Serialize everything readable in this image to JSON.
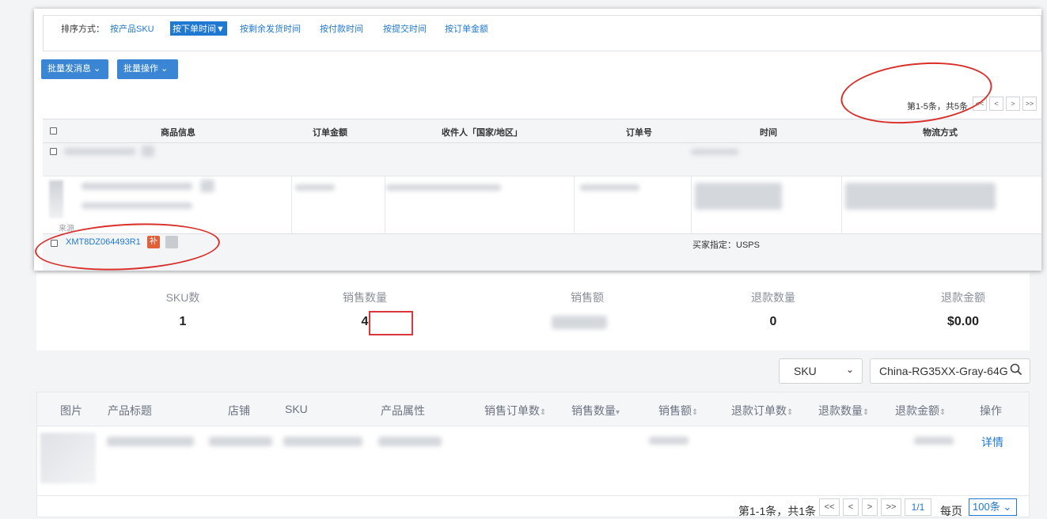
{
  "overlay": {
    "sort": {
      "label": "排序方式：",
      "options": [
        "按产品SKU",
        "按下单时间",
        "按剩余发货时间",
        "按付款时间",
        "按提交时间",
        "按订单金额"
      ],
      "active_suffix": "▼"
    },
    "buttons": {
      "batch_message": "批量发消息 ⌄",
      "batch_ops": "批量操作 ⌄"
    },
    "pager": {
      "text": "第1-5条，共5条",
      "first": "<<",
      "prev": "<",
      "next": ">",
      "last": ">>"
    },
    "table_headers": [
      "商品信息",
      "订单金额",
      "收件人「国家/地区」",
      "订单号",
      "时间",
      "物流方式"
    ],
    "order": {
      "id": "XMT8DZ064493R1",
      "badge": "补",
      "buyer_specified": "买家指定：USPS",
      "source_prefix": "来源"
    }
  },
  "stats": {
    "labels": [
      "SKU数",
      "销售数量",
      "销售额",
      "退款数量",
      "退款金额"
    ],
    "values": {
      "sku_count": "1",
      "sales_qty": "4",
      "refund_qty": "0",
      "refund_amount": "$0.00"
    }
  },
  "search": {
    "field": "SKU",
    "value": "China-RG35XX-Gray-64G"
  },
  "product_table": {
    "headers": [
      "图片",
      "产品标题",
      "店铺",
      "SKU",
      "产品属性",
      "销售订单数",
      "销售数量",
      "销售额",
      "退款订单数",
      "退款数量",
      "退款金额",
      "操作"
    ],
    "detail_link": "详情"
  },
  "pagination": {
    "text": "第1-1条，共1条",
    "first": "<<",
    "prev": "<",
    "next": ">",
    "last": ">>",
    "page": "1/1",
    "per_page_label": "每页",
    "per_page": "100条"
  },
  "colors": {
    "link_blue": "#1f78d1",
    "annotation_red": "#d9302b",
    "badge_orange": "#e0603a"
  }
}
